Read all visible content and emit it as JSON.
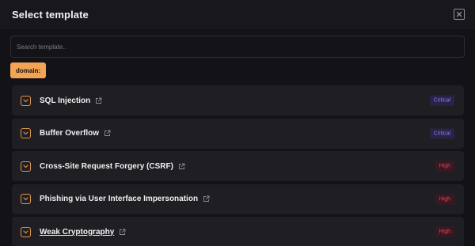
{
  "dialog": {
    "title": "Select template"
  },
  "search": {
    "placeholder": "Search template..",
    "value": ""
  },
  "filter": {
    "tag_label": "domain:"
  },
  "colors": {
    "accent": "#f2a356",
    "critical_text": "#8f7be8",
    "high_text": "#e2445c"
  },
  "templates": [
    {
      "label": "SQL Injection",
      "severity": "Critical"
    },
    {
      "label": "Buffer Overflow",
      "severity": "Critical"
    },
    {
      "label": "Cross-Site Request Forgery (CSRF)",
      "severity": "High"
    },
    {
      "label": "Phishing via User Interface Impersonation",
      "severity": "High"
    },
    {
      "label": "Weak Cryptography",
      "severity": "High"
    }
  ]
}
